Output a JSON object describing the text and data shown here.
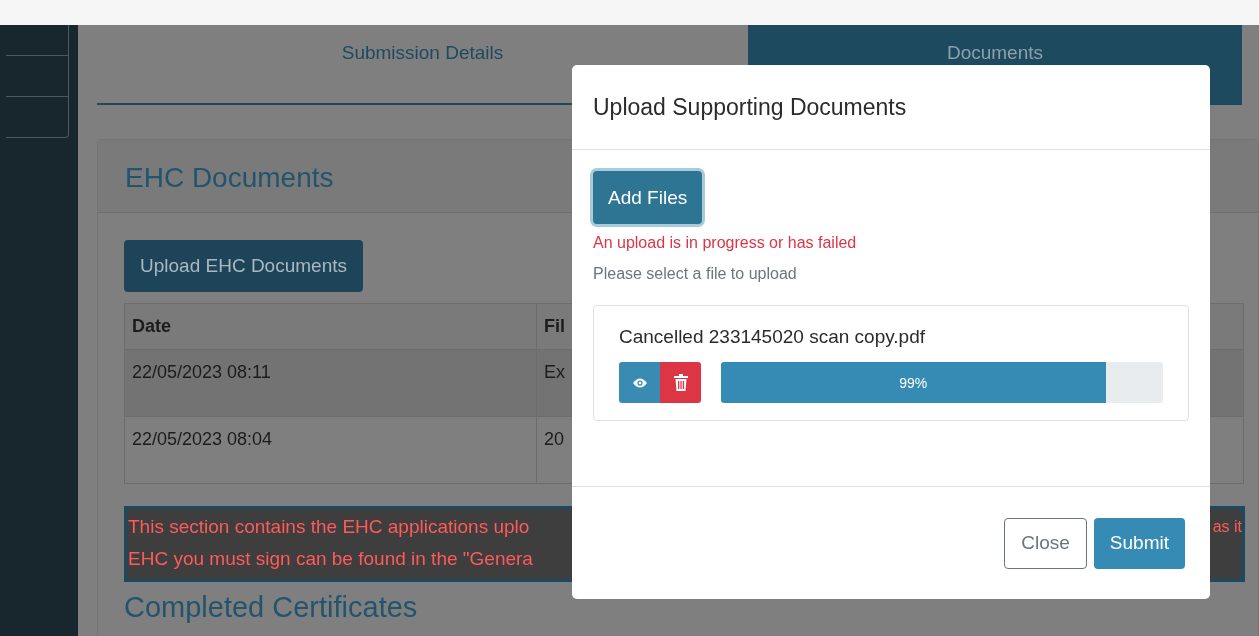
{
  "tabs": [
    {
      "label": "Submission Details",
      "selected": false
    },
    {
      "label": "Documents",
      "selected": true
    }
  ],
  "card": {
    "title": "EHC Documents",
    "upload_button": "Upload EHC Documents",
    "table": {
      "columns": [
        "Date",
        "Fil"
      ],
      "rows": [
        [
          "22/05/2023 08:11",
          "Ex"
        ],
        [
          "22/05/2023 08:04",
          "20"
        ]
      ]
    },
    "notice": {
      "lines": [
        "This section contains the EHC applications uplo",
        "EHC you must sign can be found in the \"Genera"
      ],
      "right_fragment": "as it"
    },
    "next_heading": "Completed Certificates"
  },
  "modal": {
    "title": "Upload Supporting Documents",
    "add_button": "Add Files",
    "error": "An upload is in progress or has failed",
    "hint": "Please select a file to upload",
    "files": [
      {
        "name": "Cancelled 233145020 scan copy.pdf",
        "level": 0.87,
        "reading": "99%"
      }
    ],
    "buttons": [
      {
        "label": "Close",
        "kind": "secondary"
      },
      {
        "label": "Submit",
        "kind": "primary"
      }
    ]
  }
}
